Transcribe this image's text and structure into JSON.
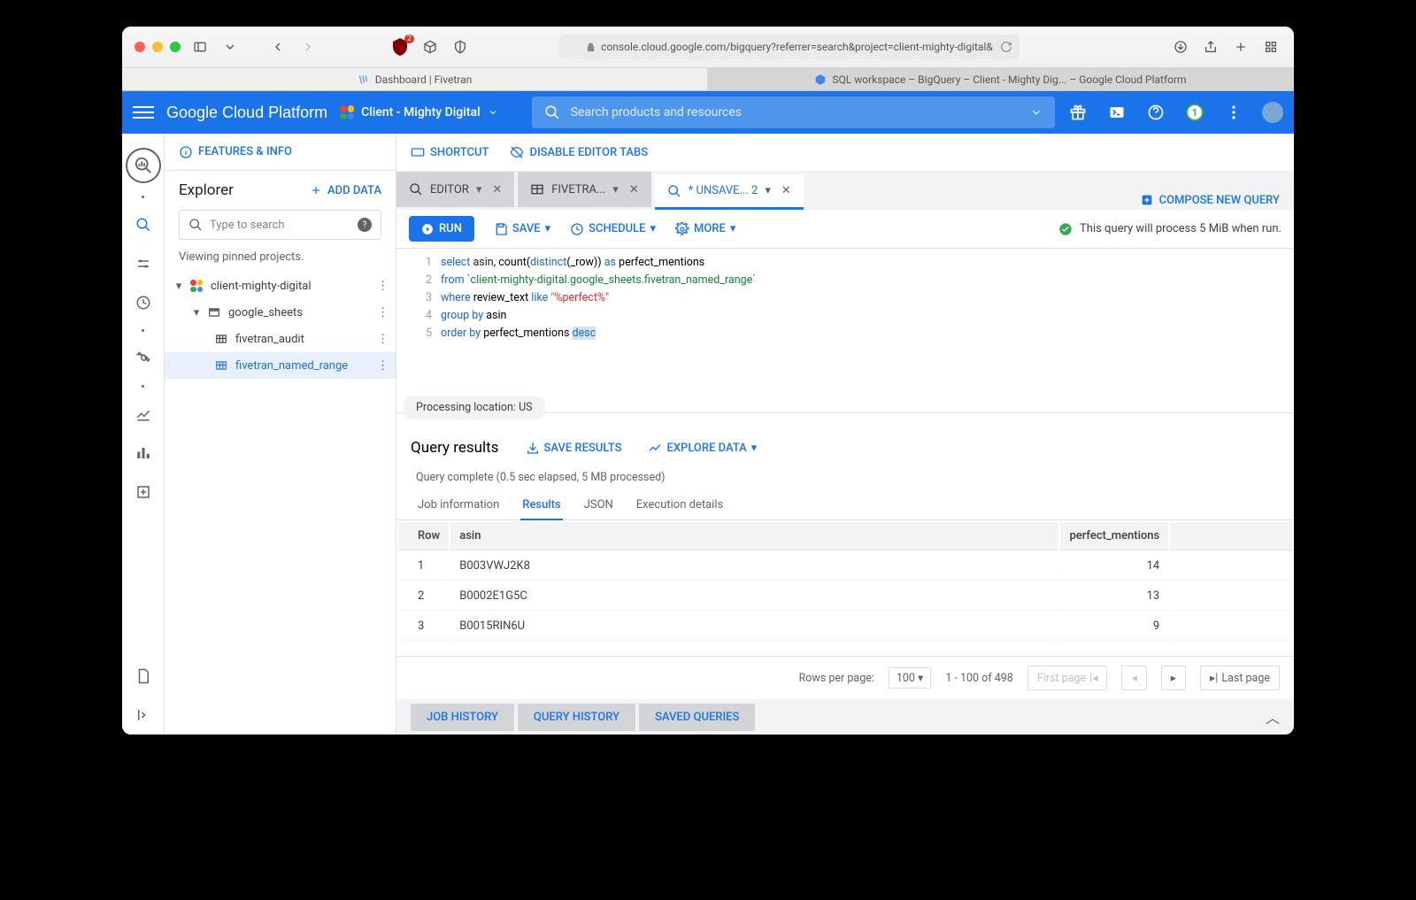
{
  "safari": {
    "url": "console.cloud.google.com/bigquery?referrer=search&project=client-mighty-digital&",
    "ublock_badge": "2",
    "tabs": [
      {
        "title": "Dashboard | Fivetran"
      },
      {
        "title": "SQL workspace – BigQuery – Client - Mighty Dig... – Google Cloud Platform"
      }
    ]
  },
  "gcp": {
    "logo": "Google Cloud Platform",
    "project": "Client - Mighty Digital",
    "search_placeholder": "Search products and resources",
    "notif_badge": "1"
  },
  "toolbar": {
    "features": "FEATURES & INFO",
    "shortcut": "SHORTCUT",
    "disable": "DISABLE EDITOR TABS"
  },
  "explorer": {
    "title": "Explorer",
    "add_data": "ADD DATA",
    "search_placeholder": "Type to search",
    "hint": "Viewing pinned projects.",
    "tree": {
      "project": "client-mighty-digital",
      "dataset": "google_sheets",
      "tables": [
        "fivetran_audit",
        "fivetran_named_range"
      ]
    }
  },
  "editor_tabs": {
    "t1": "EDITOR",
    "t2": "FIVETRA...",
    "t3": "* UNSAVE... 2",
    "compose": "COMPOSE NEW QUERY"
  },
  "actions": {
    "run": "RUN",
    "save": "SAVE",
    "schedule": "SCHEDULE",
    "more": "MORE",
    "status": "This query will process 5 MiB when run."
  },
  "sql": {
    "l1_a": "select",
    "l1_b": "asin",
    "l1_c": ", count(",
    "l1_d": "distinct",
    "l1_e": "(_row)) ",
    "l1_f": "as",
    "l1_g": " perfect_mentions",
    "l2_a": "from",
    "l2_b": " `client-mighty-digital.google_sheets.fivetran_named_range`",
    "l3_a": "where",
    "l3_b": " review_text ",
    "l3_c": "like",
    "l3_d": " \"%perfect%\"",
    "l4_a": "group by",
    "l4_b": " asin",
    "l5_a": "order by",
    "l5_b": " perfect_mentions ",
    "l5_c": "desc"
  },
  "proc_location": "Processing location: US",
  "results": {
    "title": "Query results",
    "save_results": "SAVE RESULTS",
    "explore": "EXPLORE DATA",
    "complete": "Query complete (0.5 sec elapsed, 5 MB processed)",
    "tabs": {
      "job": "Job information",
      "results": "Results",
      "json": "JSON",
      "exec": "Execution details"
    },
    "cols": {
      "row": "Row",
      "asin": "asin",
      "pm": "perfect_mentions"
    },
    "rows": [
      {
        "n": "1",
        "asin": "B003VWJ2K8",
        "pm": "14"
      },
      {
        "n": "2",
        "asin": "B0002E1G5C",
        "pm": "13"
      },
      {
        "n": "3",
        "asin": "B0015RIN6U",
        "pm": "9"
      }
    ]
  },
  "pagination": {
    "rpp_label": "Rows per page:",
    "rpp_value": "100",
    "range": "1 - 100 of 498",
    "first": "First page",
    "last": "Last page"
  },
  "bottom": {
    "job_history": "JOB HISTORY",
    "query_history": "QUERY HISTORY",
    "saved_queries": "SAVED QUERIES"
  }
}
